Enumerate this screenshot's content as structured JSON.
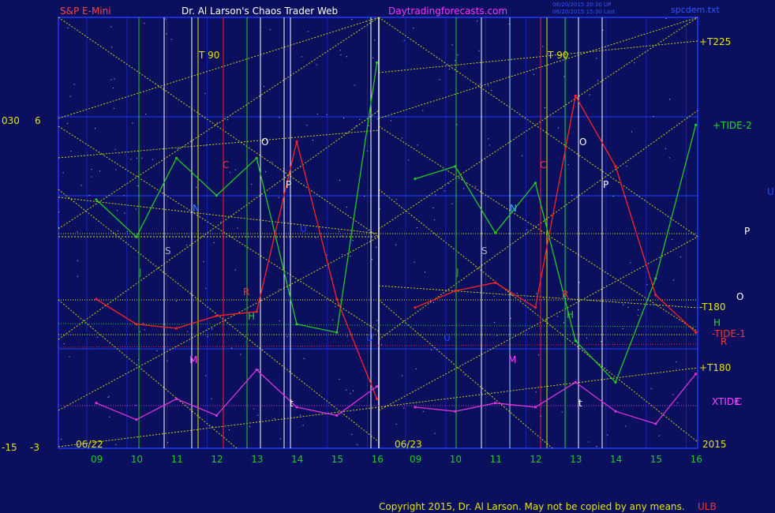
{
  "header": {
    "left": "S&P E-Mini",
    "center": "Dr. Al Larson's Chaos Trader Web",
    "site": "Daytradingforecasts.com",
    "stamp1": "06/20/2015 20:30 UP",
    "stamp2": "06/20/2015 15:30 Last",
    "file": "spcdem.txt"
  },
  "left_axis": {
    "top_a": "030",
    "top_b": "6",
    "bot_a": "-15",
    "bot_b": "-3"
  },
  "date_labels": [
    "06/22",
    "06/23"
  ],
  "year_label": "2015",
  "copyright": "Copyright 2015, Dr. Al Larson. May not be copied by any means.",
  "copyright_suffix": "ULB",
  "right_labels": {
    "t225": "+T225",
    "tide2": "+TIDE-2",
    "t180n": "-T180",
    "h": "H",
    "tide1": "-TIDE-1",
    "r": "R",
    "t180p": "+T180",
    "xtide": "XTIDE",
    "c": "C",
    "u": "U",
    "p": "P",
    "o": "O"
  },
  "marker_labels": {
    "t90": "T 90",
    "c": "C",
    "o": "O",
    "p": "P",
    "n": "N",
    "s": "S",
    "j": "J",
    "h": "H",
    "m": "M",
    "u": "U",
    "r": "R",
    "t": "t"
  },
  "colors": {
    "background": "#0a0f5e",
    "grid": "#1e3cff",
    "green": "#22cc22",
    "red": "#ff2222",
    "magenta": "#dd33dd",
    "yellow": "#e6e600",
    "white": "#ffffff"
  },
  "chart_data": {
    "type": "line",
    "x": [
      "06/22 09",
      "06/22 10",
      "06/22 11",
      "06/22 12",
      "06/22 13",
      "06/22 14",
      "06/22 15",
      "06/22 16",
      "06/23 09",
      "06/23 10",
      "06/23 11",
      "06/23 12",
      "06/23 13",
      "06/23 14",
      "06/23 15",
      "06/23 16"
    ],
    "xticks": [
      "09",
      "10",
      "11",
      "12",
      "13",
      "14",
      "15",
      "16",
      "09",
      "10",
      "11",
      "12",
      "13",
      "14",
      "15",
      "16"
    ],
    "series": [
      {
        "color": "green",
        "values": [
          0.58,
          0.49,
          0.68,
          0.59,
          0.68,
          0.28,
          0.26,
          0.91,
          0.63,
          0.66,
          0.5,
          0.62,
          0.24,
          0.14,
          0.39,
          0.76
        ]
      },
      {
        "color": "red",
        "values": [
          0.34,
          0.28,
          0.27,
          0.3,
          0.31,
          0.72,
          0.34,
          0.1,
          0.32,
          0.36,
          0.38,
          0.32,
          0.83,
          0.66,
          0.35,
          0.26
        ]
      },
      {
        "color": "magenta",
        "values": [
          0.09,
          0.05,
          0.1,
          0.06,
          0.17,
          0.08,
          0.06,
          0.13,
          0.08,
          0.07,
          0.09,
          0.08,
          0.14,
          0.07,
          0.04,
          0.16
        ]
      }
    ],
    "ylim": [
      0,
      1
    ]
  }
}
